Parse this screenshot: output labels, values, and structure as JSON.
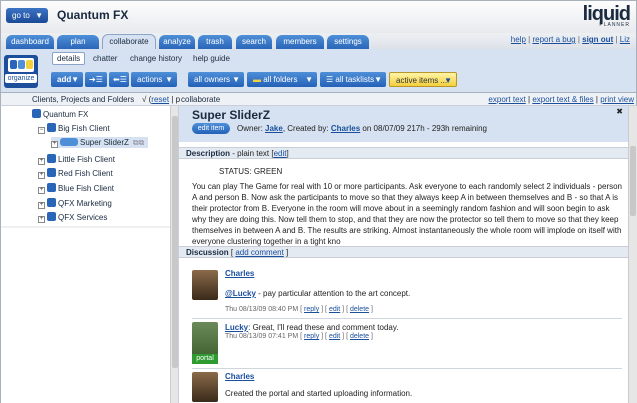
{
  "header": {
    "goto_label": "go to",
    "app_name": "Quantum FX",
    "logo_word": "liquid",
    "logo_sub": "PLANNER",
    "links": [
      "help",
      "report a bug",
      "sign out",
      "Liz"
    ]
  },
  "tabs": [
    "dashboard",
    "plan",
    "collaborate",
    "analyze",
    "trash",
    "search",
    "members",
    "settings"
  ],
  "active_tab": "collaborate",
  "organize_label": "organize",
  "subnav": {
    "items": [
      "details",
      "chatter",
      "change history",
      "help guide"
    ],
    "selected": "details"
  },
  "toolbar": {
    "add_label": "add",
    "actions_label": "actions",
    "owners_label": "all owners",
    "folders_label": "all folders",
    "tasklists_label": "all tasklists",
    "active_label": "active items ..."
  },
  "filter_bar": {
    "title": "Clients, Projects and Folders",
    "reset": "reset",
    "breadcrumb": "collaborate",
    "export_text": "export text",
    "export_files": "export text & files",
    "print_view": "print view"
  },
  "tree": [
    {
      "label": "Quantum FX",
      "expander": ""
    },
    {
      "label": "Big Fish Client",
      "expander": "−"
    },
    {
      "label": "Super SliderZ",
      "expander": "+"
    },
    {
      "label": "Little Fish Client",
      "expander": "+"
    },
    {
      "label": "Red Fish Client",
      "expander": "+"
    },
    {
      "label": "Blue Fish Client",
      "expander": "+"
    },
    {
      "label": "QFX Marketing",
      "expander": "+"
    },
    {
      "label": "QFX Services",
      "expander": "+"
    }
  ],
  "item": {
    "title": "Super SliderZ",
    "edit_label": "edit item",
    "owner_prefix": "Owner: ",
    "owner": "Jake",
    "created_prefix": ", Created by: ",
    "creator": "Charles",
    "date_info": " on 08/07/09   217h - 293h remaining"
  },
  "description": {
    "heading": "Description",
    "type": " - plain text [",
    "edit": "edit",
    "close": "]",
    "status": "STATUS: GREEN",
    "body": "You can play The Game for real with 10 or more participants. Ask everyone to each randomly select 2 individuals - person A and person B. Now ask the participants to move so that they always keep A in between themselves and B - so that A is their protector from B. Everyone in the room will move about in a seemingly random fashion and will soon begin to ask why they are doing this. Now tell them to stop, and that they are now the protector so tell them to move so that they keep themselves in between A and B. The results are striking. Almost instantaneously the whole room will implode on itself with everyone clustering together in a tight kno"
  },
  "discussion": {
    "heading": "Discussion",
    "add_comment": "add comment",
    "comments": [
      {
        "author": "Charles",
        "mention": "@Lucky",
        "text": " - pay particular attention to the art concept.",
        "date": "Thu 08/13/09 08:40 PM",
        "reply": "reply",
        "edit": "edit",
        "delete": "delete"
      },
      {
        "author": "Lucky",
        "text": "Great, I'll read these and comment today.",
        "date": "Thu 08/13/09 07:41 PM",
        "badge": "portal",
        "reply": "reply",
        "edit": "edit",
        "delete": "delete"
      },
      {
        "author": "Charles",
        "text": "Created the portal and started uploading information.",
        "date": "",
        "reply": "",
        "edit": "",
        "delete": ""
      }
    ]
  },
  "colors": {
    "tab_blue": "#2a66b8",
    "panel_blue": "#d6e2f1",
    "active_yellow": "#f3cf3c"
  }
}
